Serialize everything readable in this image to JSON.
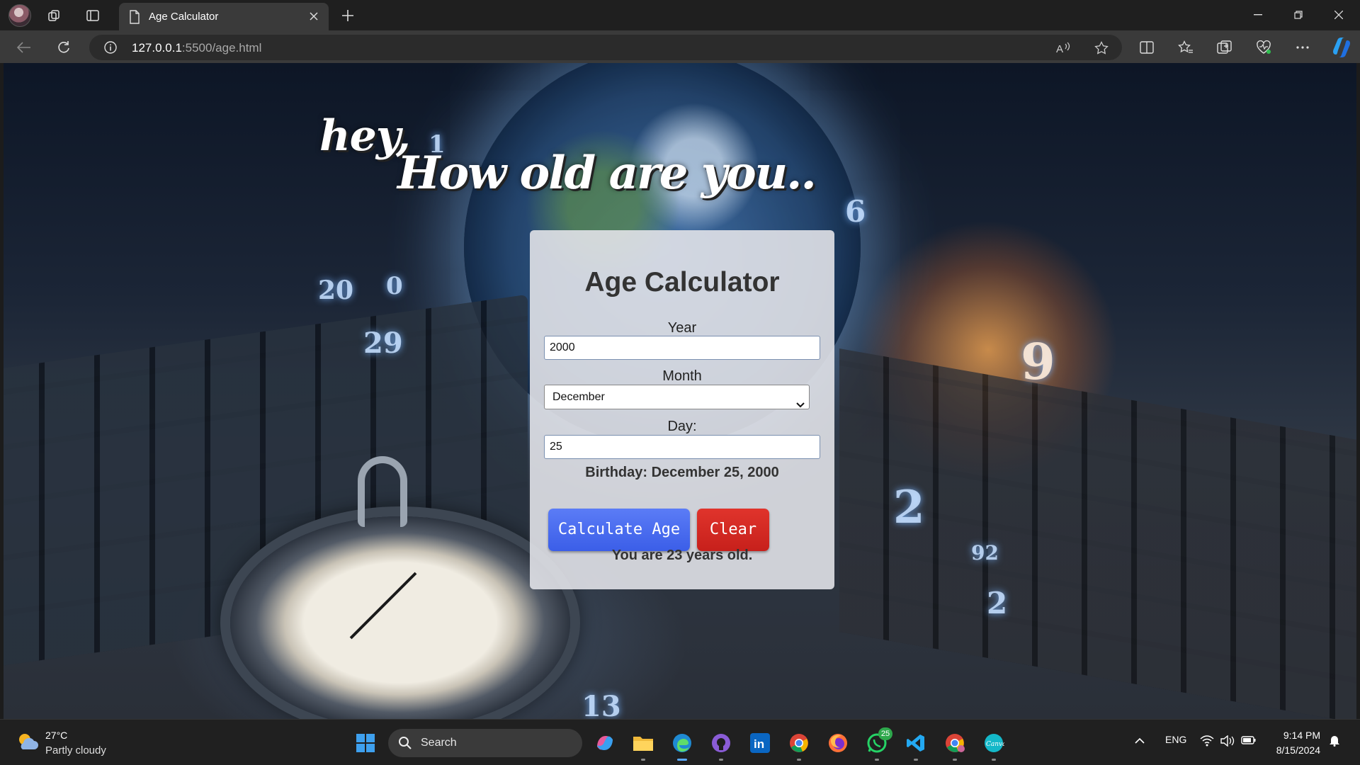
{
  "browser": {
    "tab_title": "Age Calculator",
    "url_host": "127.0.0.1",
    "url_path": ":5500/age.html"
  },
  "page": {
    "heading_line1": "hey,",
    "heading_line2": "How old are you..",
    "background_numbers": [
      "1",
      "6",
      "20",
      "0",
      "29",
      "9",
      "2",
      "92",
      "2",
      "13"
    ]
  },
  "calculator": {
    "title": "Age Calculator",
    "year_label": "Year",
    "year_value": "2000",
    "month_label": "Month",
    "month_value": "December",
    "day_label": "Day:",
    "day_value": "25",
    "birthday_text": "Birthday: December 25, 2000",
    "calculate_button": "Calculate Age",
    "clear_button": "Clear",
    "result_text": "You are 23 years old.",
    "colors": {
      "calculate": "#4b6df0",
      "clear": "#d62a23"
    }
  },
  "taskbar": {
    "weather_temp": "27°C",
    "weather_desc": "Partly cloudy",
    "search_placeholder": "Search",
    "whatsapp_badge": "25",
    "language": "ENG",
    "time": "9:14 PM",
    "date": "8/15/2024",
    "apps": [
      "windows-start",
      "search",
      "copilot",
      "file-explorer",
      "edge",
      "github",
      "linkedin",
      "chrome",
      "firefox",
      "whatsapp",
      "vscode",
      "chrome-profile",
      "canva"
    ]
  }
}
